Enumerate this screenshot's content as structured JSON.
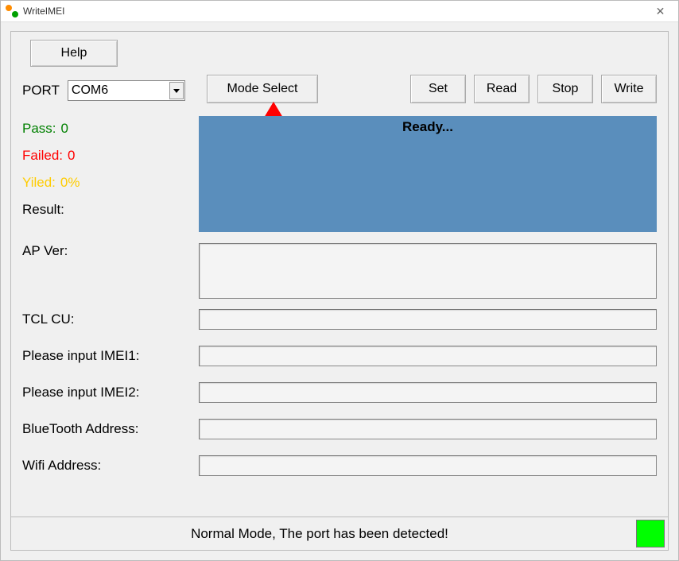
{
  "window": {
    "title": "WriteIMEI"
  },
  "toolbar": {
    "help": "Help",
    "port_label": "PORT",
    "port_value": "COM6",
    "mode_select": "Mode Select",
    "set": "Set",
    "read": "Read",
    "stop": "Stop",
    "write": "Write"
  },
  "stats": {
    "pass_label": "Pass:",
    "pass_value": "0",
    "failed_label": "Failed:",
    "failed_value": "0",
    "yiled_label": "Yiled:",
    "yiled_value": "0%",
    "result_label": "Result:"
  },
  "status": {
    "text": "Ready..."
  },
  "fields": {
    "ap_ver": {
      "label": "AP Ver:",
      "value": ""
    },
    "tcl_cu": {
      "label": "TCL CU:",
      "value": ""
    },
    "imei1": {
      "label": "Please input IMEI1:",
      "value": ""
    },
    "imei2": {
      "label": "Please input IMEI2:",
      "value": ""
    },
    "bt": {
      "label": "BlueTooth Address:",
      "value": ""
    },
    "wifi": {
      "label": "Wifi Address:",
      "value": ""
    }
  },
  "footer": {
    "message": "Normal Mode, The port has been detected!",
    "indicator_color": "#00ff00"
  },
  "annotation": {
    "arrow_target": "mode-select-button"
  }
}
